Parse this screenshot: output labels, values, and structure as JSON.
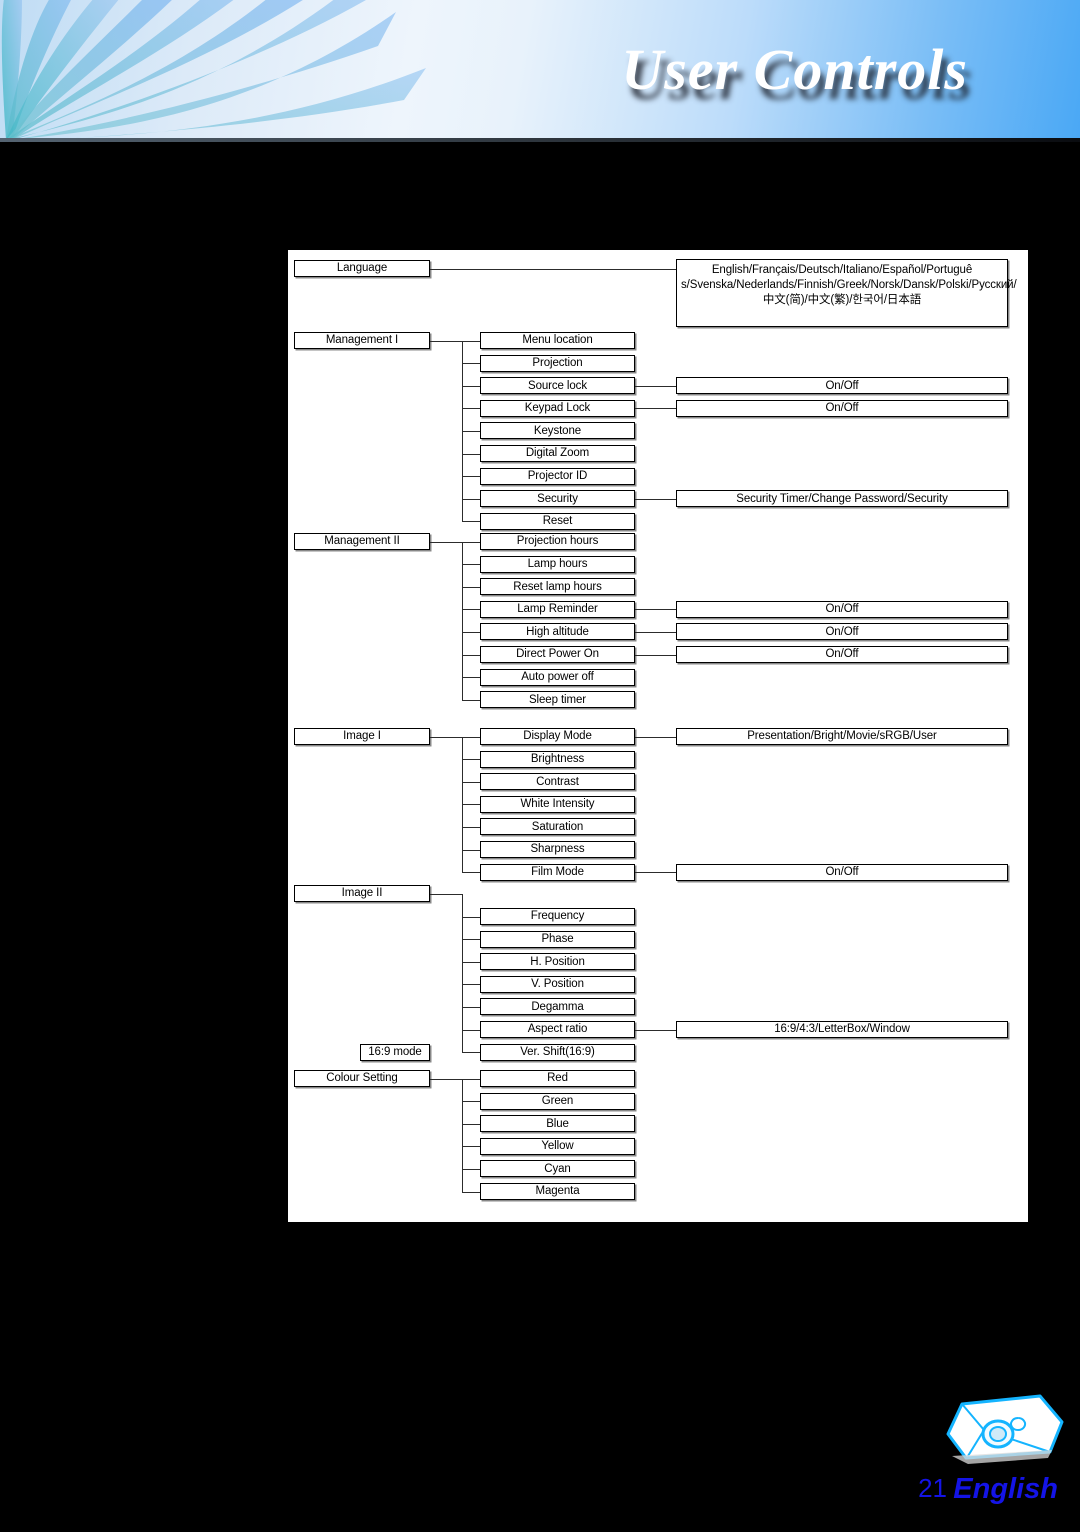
{
  "header": {
    "title": "User Controls"
  },
  "footer": {
    "page_number": "21",
    "language": "English",
    "projector_icon": "projector-icon",
    "text_color": "#1414e6"
  },
  "diagram": {
    "type": "menu-tree",
    "groups": [
      {
        "parent": "Language",
        "children": [],
        "options_inline": "English/Français/Deutsch/Italiano/Español/Portuguê s/Svenska/Nederlands/Finnish/Greek/Norsk/Dansk/Polski/Pусский/中文(简)/中文(繁)/한국어/日本語"
      },
      {
        "parent": "Management I",
        "children": [
          {
            "label": "Menu location",
            "options": ""
          },
          {
            "label": "Projection",
            "options": ""
          },
          {
            "label": "Source lock",
            "options": "On/Off"
          },
          {
            "label": "Keypad Lock",
            "options": "On/Off"
          },
          {
            "label": "Keystone",
            "options": ""
          },
          {
            "label": "Digital Zoom",
            "options": ""
          },
          {
            "label": "Projector ID",
            "options": ""
          },
          {
            "label": "Security",
            "options": "Security Timer/Change Password/Security"
          },
          {
            "label": "Reset",
            "options": ""
          }
        ]
      },
      {
        "parent": "Management II",
        "children": [
          {
            "label": "Projection hours",
            "options": ""
          },
          {
            "label": "Lamp hours",
            "options": ""
          },
          {
            "label": "Reset lamp hours",
            "options": ""
          },
          {
            "label": "Lamp Reminder",
            "options": "On/Off"
          },
          {
            "label": "High altitude",
            "options": "On/Off"
          },
          {
            "label": "Direct Power On",
            "options": "On/Off"
          },
          {
            "label": "Auto power off",
            "options": ""
          },
          {
            "label": "Sleep timer",
            "options": ""
          }
        ]
      },
      {
        "parent": "Image I",
        "children": [
          {
            "label": "Display Mode",
            "options": "Presentation/Bright/Movie/sRGB/User"
          },
          {
            "label": "Brightness",
            "options": ""
          },
          {
            "label": "Contrast",
            "options": ""
          },
          {
            "label": "White Intensity",
            "options": ""
          },
          {
            "label": "Saturation",
            "options": ""
          },
          {
            "label": "Sharpness",
            "options": ""
          },
          {
            "label": "Film Mode",
            "options": "On/Off"
          }
        ]
      },
      {
        "parent": "Image II",
        "note": "16:9 mode",
        "children": [
          {
            "label": "Frequency",
            "options": ""
          },
          {
            "label": "Phase",
            "options": ""
          },
          {
            "label": "H. Position",
            "options": ""
          },
          {
            "label": "V. Position",
            "options": ""
          },
          {
            "label": "Degamma",
            "options": ""
          },
          {
            "label": "Aspect ratio",
            "options": "16:9/4:3/LetterBox/Window"
          },
          {
            "label": "Ver. Shift(16:9)",
            "options": ""
          }
        ]
      },
      {
        "parent": "Colour Setting",
        "children": [
          {
            "label": "Red",
            "options": ""
          },
          {
            "label": "Green",
            "options": ""
          },
          {
            "label": "Blue",
            "options": ""
          },
          {
            "label": "Yellow",
            "options": ""
          },
          {
            "label": "Cyan",
            "options": ""
          },
          {
            "label": "Magenta",
            "options": ""
          }
        ]
      }
    ]
  }
}
